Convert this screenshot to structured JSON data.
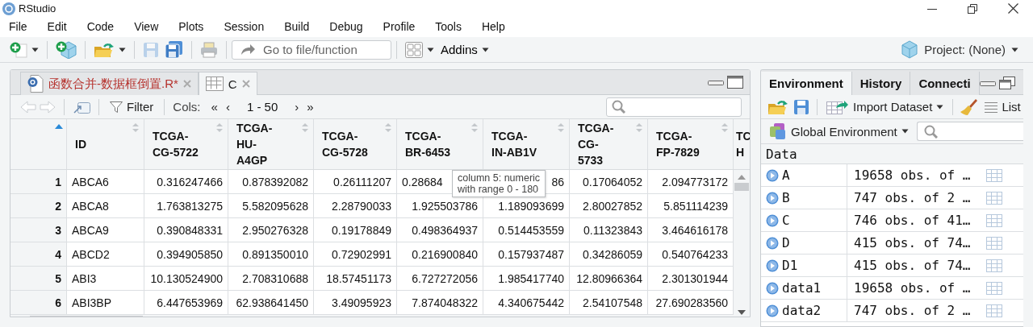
{
  "window": {
    "title": "RStudio"
  },
  "menu": [
    "File",
    "Edit",
    "Code",
    "View",
    "Plots",
    "Session",
    "Build",
    "Debug",
    "Profile",
    "Tools",
    "Help"
  ],
  "toolbar": [
    {
      "kind": "new-file",
      "dropdown": true,
      "disabled": false
    },
    {
      "kind": "new-project",
      "dropdown": false,
      "disabled": false
    },
    {
      "kind": "open",
      "dropdown": true,
      "disabled": false
    },
    {
      "kind": "save",
      "dropdown": false,
      "disabled": true
    },
    {
      "kind": "save-all",
      "dropdown": false,
      "disabled": false
    },
    {
      "kind": "print",
      "dropdown": false,
      "disabled": false
    },
    {
      "kind": "goto",
      "placeholder": "Go to file/function"
    },
    {
      "kind": "layout",
      "dropdown": true,
      "disabled": false
    },
    {
      "kind": "menu",
      "label": "Addins",
      "dropdown": true,
      "disabled": false
    }
  ],
  "project": {
    "label": "Project: (None)"
  },
  "source_pane": {
    "tabs": [
      {
        "kind": "script",
        "label": "函数合并-数据框倒置.R*",
        "modified": true,
        "selected": false
      },
      {
        "kind": "table",
        "label": "C",
        "modified": false,
        "selected": true
      }
    ],
    "viewer_toolbar": {
      "back_disabled": true,
      "forward_disabled": true,
      "filter": "Filter",
      "cols_label": "Cols:",
      "first": "«",
      "prev": "‹",
      "range": "1 - 50",
      "next": "›",
      "last": "»"
    },
    "table": {
      "columns": [
        {
          "label": "ID",
          "kind": "text",
          "sortable": true
        },
        {
          "label": "TCGA-\nCG-5722",
          "kind": "numeric",
          "sortable": true
        },
        {
          "label": "TCGA-\nHU-\nA4GP",
          "kind": "numeric",
          "sortable": true
        },
        {
          "label": "TCGA-\nCG-5728",
          "kind": "numeric",
          "sortable": true
        },
        {
          "label": "TCGA-\nBR-6453",
          "kind": "numeric",
          "sortable": true
        },
        {
          "label": "TCGA-\nIN-AB1V",
          "kind": "numeric",
          "sortable": true
        },
        {
          "label": "TCGA-\nCG-\n5733",
          "kind": "numeric",
          "sortable": true
        },
        {
          "label": "TCGA-\nFP-7829",
          "kind": "numeric",
          "sortable": true
        },
        {
          "label": "TC\nH",
          "sortable": false
        }
      ],
      "rows": [
        {
          "number": "1",
          "cells": [
            "ABCA6",
            "0.316247466",
            "0.878392082",
            "0.26111207",
            "0.28684",
            "86",
            "0.17064052",
            "2.094773172"
          ]
        },
        {
          "number": "2",
          "cells": [
            "ABCA8",
            "1.763813275",
            "5.582095628",
            "2.28790033",
            "1.925503786",
            "1.189093699",
            "2.80027852",
            "5.851114239"
          ]
        },
        {
          "number": "3",
          "cells": [
            "ABCA9",
            "0.390848331",
            "2.950276328",
            "0.19178849",
            "0.498364937",
            "0.514453559",
            "0.11323843",
            "3.464616178"
          ]
        },
        {
          "number": "4",
          "cells": [
            "ABCD2",
            "0.394905850",
            "0.891350010",
            "0.72902991",
            "0.216900840",
            "0.157937487",
            "0.34286059",
            "0.540764233"
          ]
        },
        {
          "number": "5",
          "cells": [
            "ABI3",
            "10.130524900",
            "2.708310688",
            "18.57451173",
            "6.727272056",
            "1.985417740",
            "12.80966364",
            "2.301301944"
          ]
        },
        {
          "number": "6",
          "cells": [
            "ABI3BP",
            "6.447653969",
            "62.938641450",
            "3.49095923",
            "7.874048322",
            "4.340675442",
            "2.54107548",
            "27.690283560"
          ]
        }
      ],
      "tooltip": {
        "lines": [
          "column 5: numeric",
          "with range 0 - 180"
        ]
      }
    }
  },
  "environment_pane": {
    "tabs": [
      {
        "label": "Environment",
        "selected": true
      },
      {
        "label": "History",
        "selected": false
      },
      {
        "label": "Connecti",
        "selected": false
      }
    ],
    "toolbar": {
      "import": "Import Dataset",
      "list": "List"
    },
    "scope": "Global Environment",
    "section": "Data",
    "objects": [
      {
        "name": "A",
        "value": "19658 obs. of …"
      },
      {
        "name": "B",
        "value": "747 obs. of 2 …"
      },
      {
        "name": "C",
        "value": "746 obs. of 41…"
      },
      {
        "name": "D",
        "value": "415 obs. of 74…"
      },
      {
        "name": "D1",
        "value": "415 obs. of 74…"
      },
      {
        "name": "data1",
        "value": "19658 obs. of …"
      },
      {
        "name": "data2",
        "value": "747 obs. of 2 …"
      }
    ]
  }
}
